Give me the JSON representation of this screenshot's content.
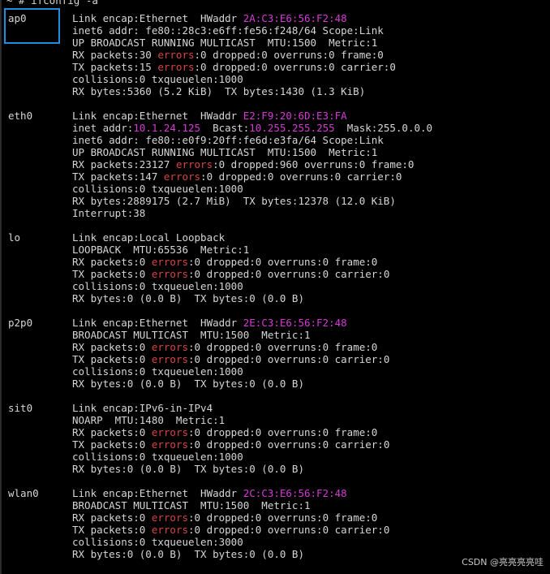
{
  "prompt": "~ # ifconfig -a",
  "watermark": "CSDN @亮亮亮亮哇",
  "colors": {
    "background": "#000000",
    "text": "#d6d6d6",
    "highlight": "#d33bd3",
    "error": "#d64545",
    "selection": "#1e8fdc"
  },
  "interfaces": [
    {
      "name": "ap0",
      "lines": [
        [
          {
            "t": "Link encap:Ethernet  HWaddr "
          },
          {
            "t": "2A:C3:E6:56:F2:48",
            "c": "hl"
          }
        ],
        [
          {
            "t": "inet6 addr: fe80::28c3:e6ff:fe56:f248/64 Scope:Link"
          }
        ],
        [
          {
            "t": "UP BROADCAST RUNNING MULTICAST  MTU:1500  Metric:1"
          }
        ],
        [
          {
            "t": "RX packets:30 "
          },
          {
            "t": "errors",
            "c": "err"
          },
          {
            "t": ":0 dropped:0 overruns:0 frame:0"
          }
        ],
        [
          {
            "t": "TX packets:15 "
          },
          {
            "t": "errors",
            "c": "err"
          },
          {
            "t": ":0 dropped:0 overruns:0 carrier:0"
          }
        ],
        [
          {
            "t": "collisions:0 txqueuelen:1000"
          }
        ],
        [
          {
            "t": "RX bytes:5360 (5.2 KiB)  TX bytes:1430 (1.3 KiB)"
          }
        ]
      ]
    },
    {
      "name": "eth0",
      "lines": [
        [
          {
            "t": "Link encap:Ethernet  HWaddr "
          },
          {
            "t": "E2:F9:20:6D:E3:FA",
            "c": "hl"
          }
        ],
        [
          {
            "t": "inet addr:"
          },
          {
            "t": "10.1.24.125",
            "c": "hl"
          },
          {
            "t": "  Bcast:"
          },
          {
            "t": "10.255.255.255",
            "c": "hl"
          },
          {
            "t": "  Mask:255.0.0.0"
          }
        ],
        [
          {
            "t": "inet6 addr: fe80::e0f9:20ff:fe6d:e3fa/64 Scope:Link"
          }
        ],
        [
          {
            "t": "UP BROADCAST RUNNING MULTICAST  MTU:1500  Metric:1"
          }
        ],
        [
          {
            "t": "RX packets:23127 "
          },
          {
            "t": "errors",
            "c": "err"
          },
          {
            "t": ":0 dropped:960 overruns:0 frame:0"
          }
        ],
        [
          {
            "t": "TX packets:147 "
          },
          {
            "t": "errors",
            "c": "err"
          },
          {
            "t": ":0 dropped:0 overruns:0 carrier:0"
          }
        ],
        [
          {
            "t": "collisions:0 txqueuelen:1000"
          }
        ],
        [
          {
            "t": "RX bytes:2889175 (2.7 MiB)  TX bytes:12378 (12.0 KiB)"
          }
        ],
        [
          {
            "t": "Interrupt:38"
          }
        ]
      ]
    },
    {
      "name": "lo",
      "lines": [
        [
          {
            "t": "Link encap:Local Loopback"
          }
        ],
        [
          {
            "t": "LOOPBACK  MTU:65536  Metric:1"
          }
        ],
        [
          {
            "t": "RX packets:0 "
          },
          {
            "t": "errors",
            "c": "err"
          },
          {
            "t": ":0 dropped:0 overruns:0 frame:0"
          }
        ],
        [
          {
            "t": "TX packets:0 "
          },
          {
            "t": "errors",
            "c": "err"
          },
          {
            "t": ":0 dropped:0 overruns:0 carrier:0"
          }
        ],
        [
          {
            "t": "collisions:0 txqueuelen:1000"
          }
        ],
        [
          {
            "t": "RX bytes:0 (0.0 B)  TX bytes:0 (0.0 B)"
          }
        ]
      ]
    },
    {
      "name": "p2p0",
      "lines": [
        [
          {
            "t": "Link encap:Ethernet  HWaddr "
          },
          {
            "t": "2E:C3:E6:56:F2:48",
            "c": "hl"
          }
        ],
        [
          {
            "t": "BROADCAST MULTICAST  MTU:1500  Metric:1"
          }
        ],
        [
          {
            "t": "RX packets:0 "
          },
          {
            "t": "errors",
            "c": "err"
          },
          {
            "t": ":0 dropped:0 overruns:0 frame:0"
          }
        ],
        [
          {
            "t": "TX packets:0 "
          },
          {
            "t": "errors",
            "c": "err"
          },
          {
            "t": ":0 dropped:0 overruns:0 carrier:0"
          }
        ],
        [
          {
            "t": "collisions:0 txqueuelen:1000"
          }
        ],
        [
          {
            "t": "RX bytes:0 (0.0 B)  TX bytes:0 (0.0 B)"
          }
        ]
      ]
    },
    {
      "name": "sit0",
      "lines": [
        [
          {
            "t": "Link encap:IPv6-in-IPv4"
          }
        ],
        [
          {
            "t": "NOARP  MTU:1480  Metric:1"
          }
        ],
        [
          {
            "t": "RX packets:0 "
          },
          {
            "t": "errors",
            "c": "err"
          },
          {
            "t": ":0 dropped:0 overruns:0 frame:0"
          }
        ],
        [
          {
            "t": "TX packets:0 "
          },
          {
            "t": "errors",
            "c": "err"
          },
          {
            "t": ":0 dropped:0 overruns:0 carrier:0"
          }
        ],
        [
          {
            "t": "collisions:0 txqueuelen:1000"
          }
        ],
        [
          {
            "t": "RX bytes:0 (0.0 B)  TX bytes:0 (0.0 B)"
          }
        ]
      ]
    },
    {
      "name": "wlan0",
      "lines": [
        [
          {
            "t": "Link encap:Ethernet  HWaddr "
          },
          {
            "t": "2C:C3:E6:56:F2:48",
            "c": "hl"
          }
        ],
        [
          {
            "t": "BROADCAST MULTICAST  MTU:1500  Metric:1"
          }
        ],
        [
          {
            "t": "RX packets:0 "
          },
          {
            "t": "errors",
            "c": "err"
          },
          {
            "t": ":0 dropped:0 overruns:0 frame:0"
          }
        ],
        [
          {
            "t": "TX packets:0 "
          },
          {
            "t": "errors",
            "c": "err"
          },
          {
            "t": ":0 dropped:0 overruns:0 carrier:0"
          }
        ],
        [
          {
            "t": "collisions:0 txqueuelen:3000"
          }
        ],
        [
          {
            "t": "RX bytes:0 (0.0 B)  TX bytes:0 (0.0 B)"
          }
        ]
      ]
    }
  ]
}
